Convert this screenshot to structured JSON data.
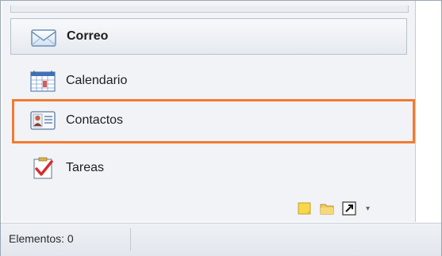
{
  "nav": {
    "items": [
      {
        "label": "Correo",
        "icon": "mail-icon",
        "selected": true
      },
      {
        "label": "Calendario",
        "icon": "calendar-icon"
      },
      {
        "label": "Contactos",
        "icon": "contacts-icon",
        "highlighted": true
      },
      {
        "label": "Tareas",
        "icon": "tasks-icon"
      }
    ],
    "small_icons": [
      "notes-icon",
      "folder-icon",
      "shortcut-icon",
      "configure-buttons-dropdown-icon"
    ]
  },
  "status_bar": {
    "items_text": "Elementos: 0"
  },
  "colors": {
    "highlight": "#f37a32",
    "nav_background": "#f1f3f6"
  }
}
